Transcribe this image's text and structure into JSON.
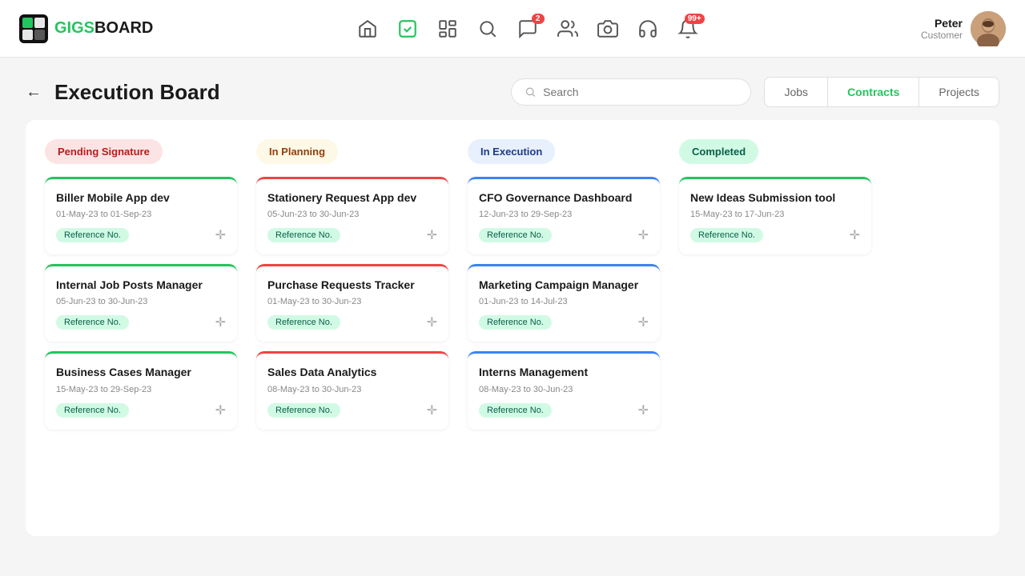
{
  "header": {
    "logo_text_main": "GIGS",
    "logo_text_sub": "BOARD",
    "nav_icons": [
      {
        "name": "home-icon",
        "symbol": "🏠"
      },
      {
        "name": "task-icon",
        "symbol": "✓"
      },
      {
        "name": "board-icon",
        "symbol": "▦"
      },
      {
        "name": "search-icon",
        "symbol": "🔍"
      },
      {
        "name": "chat-icon",
        "symbol": "💬",
        "badge": "2"
      },
      {
        "name": "users-icon",
        "symbol": "👥"
      },
      {
        "name": "camera-icon",
        "symbol": "📷"
      },
      {
        "name": "headset-icon",
        "symbol": "🎧"
      },
      {
        "name": "notification-icon",
        "symbol": "🔔",
        "badge": "99+"
      }
    ],
    "user": {
      "name": "Peter",
      "role": "Customer"
    }
  },
  "page": {
    "title": "Execution Board",
    "back_label": "←",
    "search_placeholder": "Search"
  },
  "tabs": [
    {
      "label": "Jobs",
      "active": false
    },
    {
      "label": "Contracts",
      "active": true
    },
    {
      "label": "Projects",
      "active": false
    }
  ],
  "columns": [
    {
      "id": "pending",
      "header": "Pending Signature",
      "style": "pending",
      "cards": [
        {
          "title": "Biller Mobile App dev",
          "date": "01-May-23 to 01-Sep-23",
          "ref": "Reference No.",
          "top": "green"
        },
        {
          "title": "Internal Job Posts Manager",
          "date": "05-Jun-23 to 30-Jun-23",
          "ref": "Reference No.",
          "top": "green"
        },
        {
          "title": "Business Cases Manager",
          "date": "15-May-23 to 29-Sep-23",
          "ref": "Reference No.",
          "top": "green"
        }
      ]
    },
    {
      "id": "planning",
      "header": "In Planning",
      "style": "planning",
      "cards": [
        {
          "title": "Stationery Request App dev",
          "date": "05-Jun-23 to 30-Jun-23",
          "ref": "Reference No.",
          "top": "red"
        },
        {
          "title": "Purchase Requests Tracker",
          "date": "01-May-23 to 30-Jun-23",
          "ref": "Reference No.",
          "top": "red"
        },
        {
          "title": "Sales Data Analytics",
          "date": "08-May-23 to 30-Jun-23",
          "ref": "Reference No.",
          "top": "red"
        }
      ]
    },
    {
      "id": "execution",
      "header": "In Execution",
      "style": "execution",
      "cards": [
        {
          "title": "CFO Governance Dashboard",
          "date": "12-Jun-23 to 29-Sep-23",
          "ref": "Reference No.",
          "top": "blue"
        },
        {
          "title": "Marketing Campaign Manager",
          "date": "01-Jun-23 to 14-Jul-23",
          "ref": "Reference No.",
          "top": "blue"
        },
        {
          "title": "Interns Management",
          "date": "08-May-23 to 30-Jun-23",
          "ref": "Reference No.",
          "top": "blue"
        }
      ]
    },
    {
      "id": "completed",
      "header": "Completed",
      "style": "completed",
      "cards": [
        {
          "title": "New Ideas Submission tool",
          "date": "15-May-23 to 17-Jun-23",
          "ref": "Reference No.",
          "top": "green"
        }
      ]
    }
  ]
}
